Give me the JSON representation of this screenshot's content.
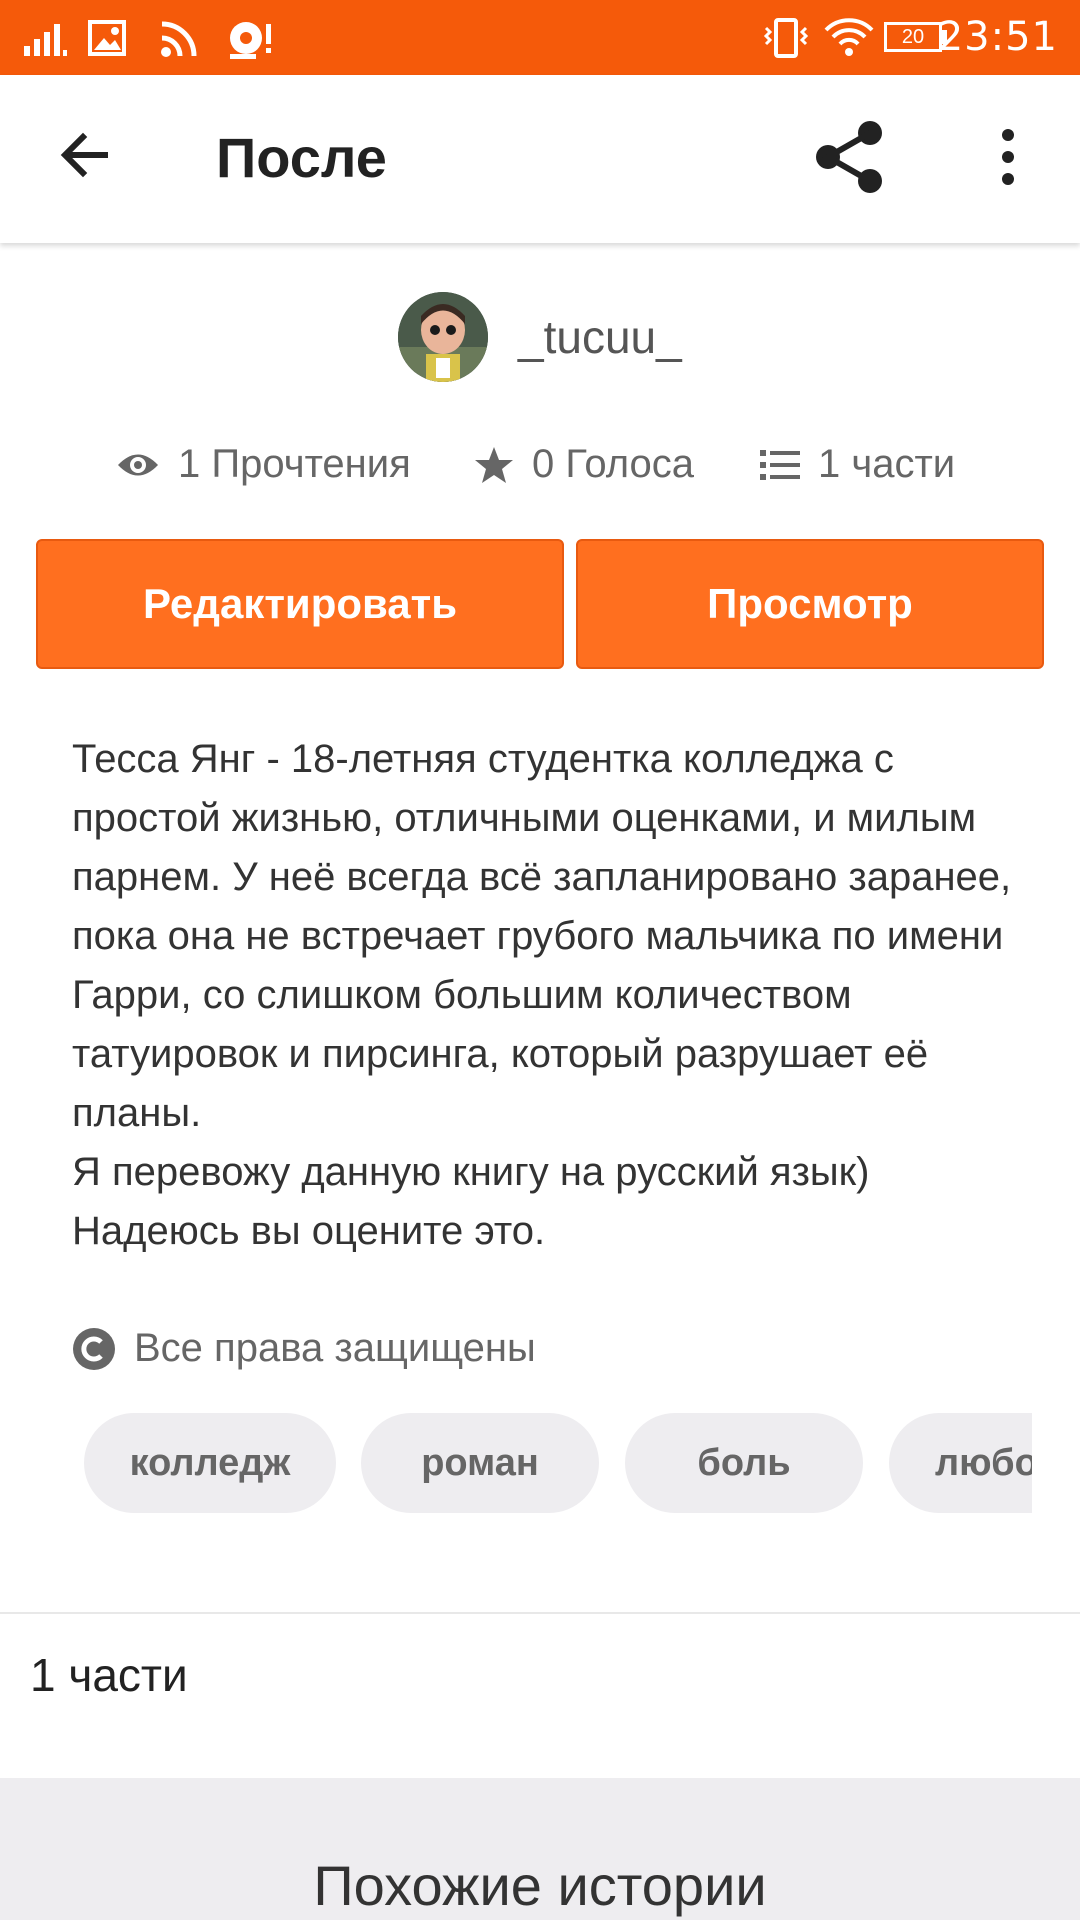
{
  "status_bar": {
    "time": "23:51",
    "battery_level": "20",
    "icons": [
      "signal-icon",
      "image-icon",
      "rss-icon",
      "podcast-icon",
      "vibrate-icon",
      "wifi-icon",
      "battery-icon"
    ]
  },
  "app_bar": {
    "title": "После",
    "icons": [
      "back-arrow-icon",
      "share-icon",
      "more-vert-icon"
    ]
  },
  "author": {
    "name": "_tucuu_"
  },
  "stats": {
    "reads": "1 Прочтения",
    "votes": "0 Голоса",
    "parts": "1 части"
  },
  "buttons": {
    "edit": "Редактировать",
    "preview": "Просмотр"
  },
  "description": [
    "Тесса Янг - 18-летняя студентка колледжа с простой жизнью, отличными оценками, и милым парнем. У неё всегда всё запланировано заранее, пока она не встречает грубого мальчика по имени Гарри, со слишком большим количеством татуировок и пирсинга, который разрушает её планы.",
    "Я перевожу данную книгу на русский язык)",
    "Надеюсь вы оцените это."
  ],
  "copyright": "Все права защищены",
  "tags": [
    "колледж",
    "роман",
    "боль",
    "любо"
  ],
  "parts_section": {
    "label": "1 части"
  },
  "similar": {
    "heading": "Похожие истории"
  },
  "colors": {
    "status_bar": "#f55a0a",
    "accent": "#ff6f1f",
    "tag_bg": "#eeedf0"
  }
}
